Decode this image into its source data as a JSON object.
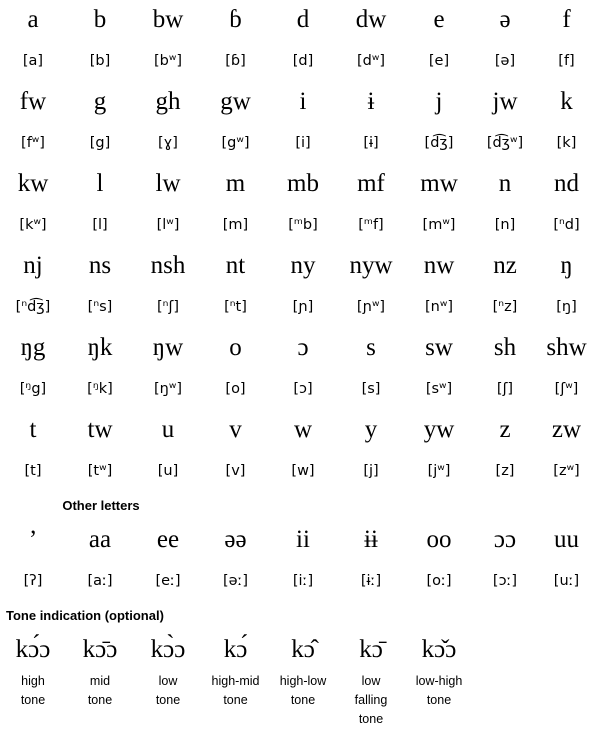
{
  "page": {
    "other_letters_heading": "Other letters",
    "tone_heading": "Tone indication (optional)"
  },
  "main_rows": [
    {
      "letters": [
        "a",
        "b",
        "bw",
        "ɓ",
        "d",
        "dw",
        "e",
        "ə",
        "f"
      ],
      "ipa": [
        "[a]",
        "[b]",
        "[bʷ]",
        "[ɓ]",
        "[d]",
        "[dʷ]",
        "[e]",
        "[ə]",
        "[f]"
      ]
    },
    {
      "letters": [
        "fw",
        "g",
        "gh",
        "gw",
        "i",
        "ɨ",
        "j",
        "jw",
        "k"
      ],
      "ipa": [
        "[fʷ]",
        "[g]",
        "[ɣ]",
        "[gʷ]",
        "[i]",
        "[ɨ]",
        "[d͡ʒ]",
        "[d͡ʒʷ]",
        "[k]"
      ]
    },
    {
      "letters": [
        "kw",
        "l",
        "lw",
        "m",
        "mb",
        "mf",
        "mw",
        "n",
        "nd"
      ],
      "ipa": [
        "[kʷ]",
        "[l]",
        "[lʷ]",
        "[m]",
        "[ᵐb]",
        "[ᵐf]",
        "[mʷ]",
        "[n]",
        "[ⁿd]"
      ]
    },
    {
      "letters": [
        "nj",
        "ns",
        "nsh",
        "nt",
        "ny",
        "nyw",
        "nw",
        "nz",
        "ŋ"
      ],
      "ipa": [
        "[ⁿd͡ʒ]",
        "[ⁿs]",
        "[ⁿʃ]",
        "[ⁿt]",
        "[ɲ]",
        "[ɲʷ]",
        "[nʷ]",
        "[ⁿz]",
        "[ŋ]"
      ]
    },
    {
      "letters": [
        "ŋg",
        "ŋk",
        "ŋw",
        "o",
        "ɔ",
        "s",
        "sw",
        "sh",
        "shw"
      ],
      "ipa": [
        "[ᵑg]",
        "[ᵑk]",
        "[ŋʷ]",
        "[o]",
        "[ɔ]",
        "[s]",
        "[sʷ]",
        "[ʃ]",
        "[ʃʷ]"
      ]
    },
    {
      "letters": [
        "t",
        "tw",
        "u",
        "v",
        "w",
        "y",
        "yw",
        "z",
        "zw"
      ],
      "ipa": [
        "[t]",
        "[tʷ]",
        "[u]",
        "[v]",
        "[w]",
        "[j]",
        "[jʷ]",
        "[z]",
        "[zʷ]"
      ]
    }
  ],
  "other_letters": {
    "letters": [
      "’",
      "aa",
      "ee",
      "əə",
      "ii",
      "ɨɨ",
      "oo",
      "ɔɔ",
      "uu"
    ],
    "ipa": [
      "[ʔ]",
      "[aː]",
      "[eː]",
      "[əː]",
      "[iː]",
      "[ɨː]",
      "[oː]",
      "[ɔː]",
      "[uː]"
    ]
  },
  "tone": {
    "letters": [
      "kɔ́ɔ",
      "kɔ̄ɔ",
      "kɔ̀ɔ",
      "kɔ́",
      "kɔ̂",
      "kɔ̄",
      "kɔ̌ɔ"
    ],
    "labels": [
      [
        "high",
        "tone"
      ],
      [
        "mid",
        "tone"
      ],
      [
        "low",
        "tone"
      ],
      [
        "high-mid",
        "tone"
      ],
      [
        "high-low",
        "tone"
      ],
      [
        "low",
        "falling",
        "tone"
      ],
      [
        "low-high",
        "tone"
      ]
    ]
  }
}
